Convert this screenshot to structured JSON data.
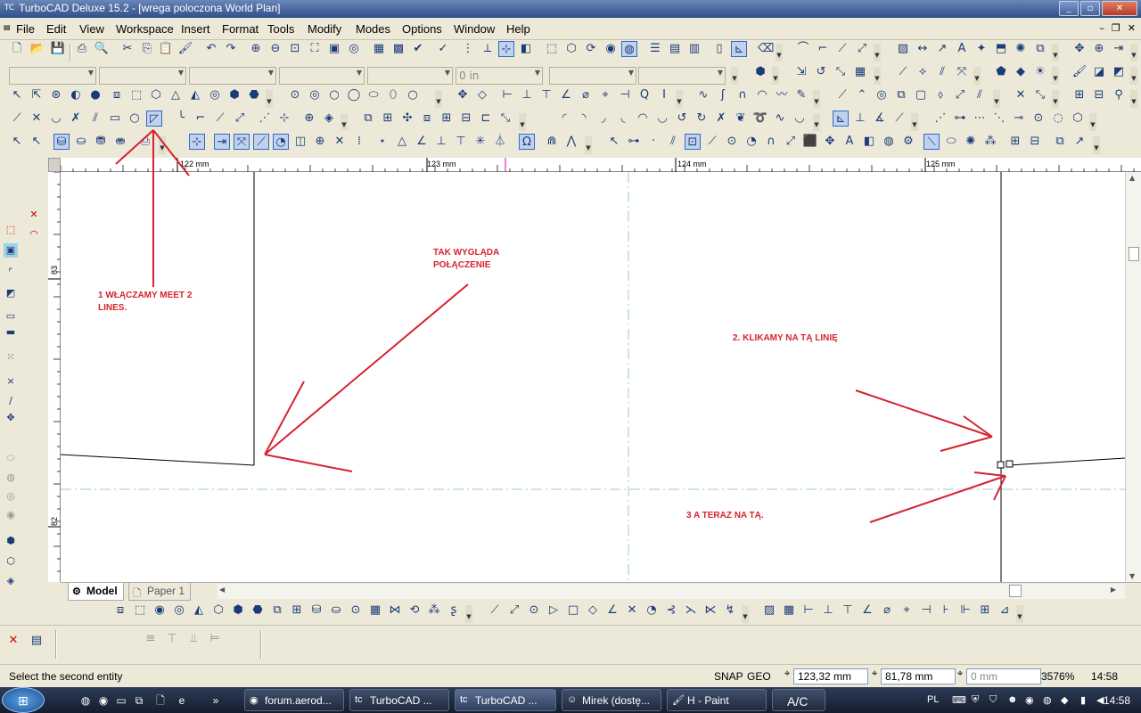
{
  "window": {
    "title": "TurboCAD Deluxe 15.2 - [wrega poloczona World Plan]",
    "minimize": "_",
    "maximize": "▫",
    "close": "✕"
  },
  "menu": [
    "File",
    "Edit",
    "View",
    "Workspace",
    "Insert",
    "Format",
    "Tools",
    "Modify",
    "Modes",
    "Options",
    "Window",
    "Help"
  ],
  "property_bar": {
    "line_width": "0 in"
  },
  "rulers": {
    "h_labels": [
      "122 mm",
      "123 mm",
      "124 mm",
      "125 mm"
    ],
    "v_labels": [
      "83 mm",
      "82 mm"
    ]
  },
  "annotations": {
    "step1": "1 WŁĄCZAMY MEET 2 LINES.",
    "looks_like": "TAK WYGLĄDA POŁĄCZENIE",
    "step2": "2. KLIKAMY NA TĄ LINIĘ",
    "step3": "3 A TERAZ NA TĄ."
  },
  "tabs": {
    "model": "Model",
    "paper": "Paper 1"
  },
  "status": {
    "message": "Select the second entity",
    "snap": "SNAP",
    "geo": "GEO",
    "x": "123,32 mm",
    "y": "81,78 mm",
    "z": "0 mm",
    "zoom": "3576%",
    "time": "14:58"
  },
  "taskbar": {
    "tasks": [
      "forum.aerod...",
      "TurboCAD ...",
      "TurboCAD ...",
      "Mirek (dostę...",
      "H - Paint",
      "A/C"
    ],
    "lang": "PL",
    "clock": "14:58"
  },
  "colors": {
    "annotation": "#d6232f",
    "titlebar": "#2e4f8a"
  }
}
